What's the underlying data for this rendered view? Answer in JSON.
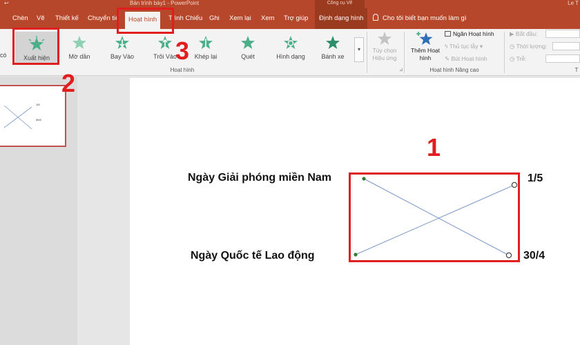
{
  "titlebar": {
    "qat": "↩",
    "document_title": "Bản trình bày1  -  PowerPoint",
    "context_group": "Công cụ Vẽ",
    "user": "Le T"
  },
  "tabs": [
    {
      "label": "Chèn"
    },
    {
      "label": "Vẽ"
    },
    {
      "label": "Thiết kế"
    },
    {
      "label": "Chuyển tiếp"
    },
    {
      "label": "Hoạt hình"
    },
    {
      "label": "Trình Chiếu"
    },
    {
      "label": "Ghi"
    },
    {
      "label": "Xem lại"
    },
    {
      "label": "Xem"
    },
    {
      "label": "Trợ giúp"
    },
    {
      "label": "Định dạng hình"
    }
  ],
  "tell_me": "Cho tôi biết bạn muốn làm gì",
  "ribbon": {
    "preview_partial": "có",
    "gallery": [
      {
        "label": "Xuất hiện"
      },
      {
        "label": "Mờ dần"
      },
      {
        "label": "Bay Vào"
      },
      {
        "label": "Trôi Vào"
      },
      {
        "label": "Khép lại"
      },
      {
        "label": "Quét"
      },
      {
        "label": "Hình dạng"
      },
      {
        "label": "Bánh xe"
      }
    ],
    "gallery_group_label": "Hoạt hình",
    "effect_options": {
      "line1": "Tùy chọn",
      "line2": "Hiệu ứng"
    },
    "add_animation": {
      "line1": "Thêm Hoạt",
      "line2": "hình"
    },
    "animation_pane": "Ngăn Hoạt hình",
    "trigger": "Thủ tục lẫy",
    "animation_painter": "Bút Hoạt hình",
    "advanced_group_label": "Hoạt hình Nâng cao",
    "start_label": "Bắt đầu:",
    "duration_label": "Thời lượng:",
    "delay_label": "Trễ:",
    "timing_group_label": "T"
  },
  "thumbnail": {
    "label1": "1/5",
    "label2": "30/4"
  },
  "slide": {
    "text_top_left": "Ngày Giải phóng miền Nam",
    "text_bottom_left": "Ngày Quốc tế Lao động",
    "text_top_right": "1/5",
    "text_bottom_right": "30/4"
  },
  "annotations": {
    "n1": "1",
    "n2": "2",
    "n3": "3"
  },
  "colors": {
    "accent": "#b7472a",
    "highlight": "#e11d1d",
    "star": "#4caf8a",
    "line": "#7b97c9"
  }
}
